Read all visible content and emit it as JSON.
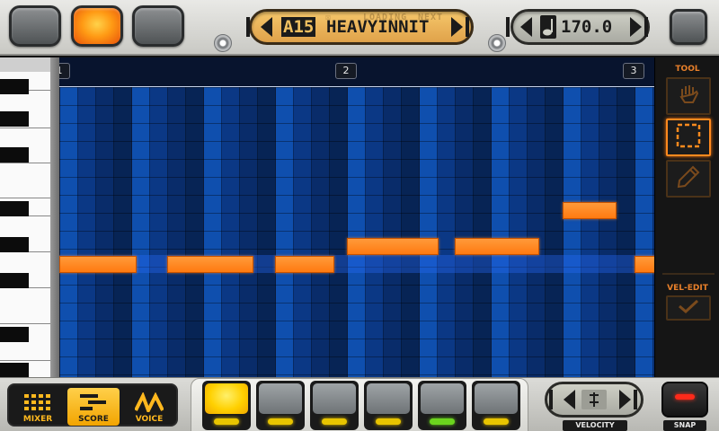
{
  "pattern": {
    "id": "A15",
    "name": "HEAVYINNIT",
    "status_loading": "LOADING",
    "status_next": "NEXT",
    "status_mark": "☒"
  },
  "tempo": {
    "value": "170.0"
  },
  "ruler": {
    "bars": [
      "1",
      "2",
      "3"
    ]
  },
  "tools": {
    "title": "TOOL",
    "items": [
      "hand",
      "select",
      "pencil"
    ],
    "active": "select",
    "vel_edit_label": "VEL-EDIT"
  },
  "modes": {
    "items": [
      "MIXER",
      "SCORE",
      "VOICE"
    ],
    "active": "SCORE"
  },
  "tracks": {
    "count": 6,
    "selected": 0,
    "led_colors": [
      "#e8c400",
      "#e8c400",
      "#e8c400",
      "#e8c400",
      "#6bd41e",
      "#e8c400"
    ]
  },
  "velocity": {
    "label": "VELOCITY"
  },
  "snap": {
    "label": "SNAP"
  },
  "colors": {
    "accent": "#ff8a1e",
    "grid": "#0b2a63",
    "note": "#ff7a10"
  }
}
